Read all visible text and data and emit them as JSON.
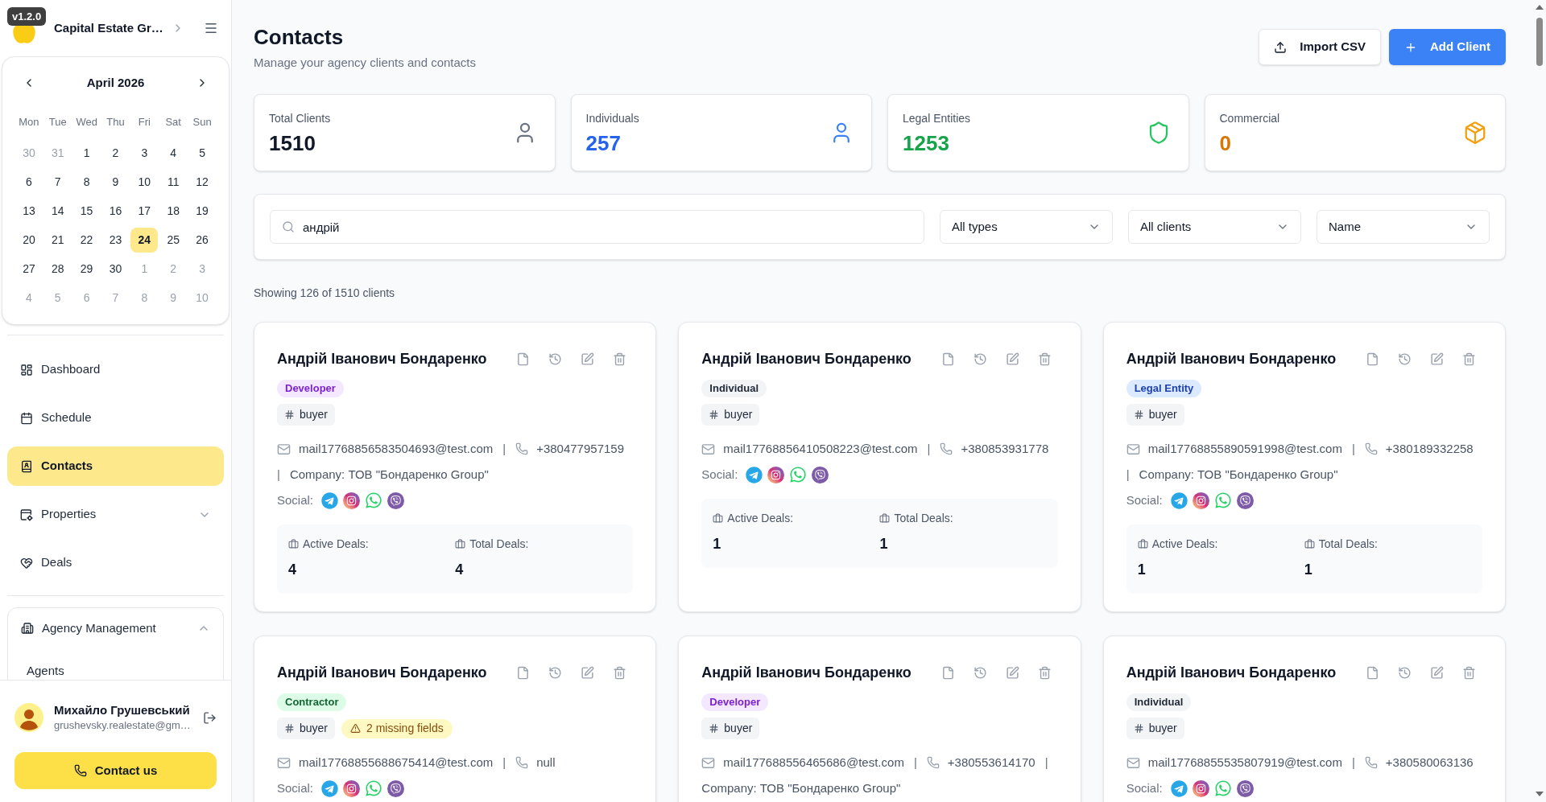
{
  "sidebar": {
    "version": "v1.2.0",
    "org_name": "Capital Estate Gr…",
    "calendar": {
      "month": "April 2026",
      "weekdays": [
        "Mon",
        "Tue",
        "Wed",
        "Thu",
        "Fri",
        "Sat",
        "Sun"
      ],
      "weeks": [
        [
          {
            "day": "30",
            "outside_month": true,
            "selected": false
          },
          {
            "day": "31",
            "outside_month": true,
            "selected": false
          },
          {
            "day": "1",
            "outside_month": false,
            "selected": false
          },
          {
            "day": "2",
            "outside_month": false,
            "selected": false
          },
          {
            "day": "3",
            "outside_month": false,
            "selected": false
          },
          {
            "day": "4",
            "outside_month": false,
            "selected": false
          },
          {
            "day": "5",
            "outside_month": false,
            "selected": false
          }
        ],
        [
          {
            "day": "6",
            "outside_month": false,
            "selected": false
          },
          {
            "day": "7",
            "outside_month": false,
            "selected": false
          },
          {
            "day": "8",
            "outside_month": false,
            "selected": false
          },
          {
            "day": "9",
            "outside_month": false,
            "selected": false
          },
          {
            "day": "10",
            "outside_month": false,
            "selected": false
          },
          {
            "day": "11",
            "outside_month": false,
            "selected": false
          },
          {
            "day": "12",
            "outside_month": false,
            "selected": false
          }
        ],
        [
          {
            "day": "13",
            "outside_month": false,
            "selected": false
          },
          {
            "day": "14",
            "outside_month": false,
            "selected": false
          },
          {
            "day": "15",
            "outside_month": false,
            "selected": false
          },
          {
            "day": "16",
            "outside_month": false,
            "selected": false
          },
          {
            "day": "17",
            "outside_month": false,
            "selected": false
          },
          {
            "day": "18",
            "outside_month": false,
            "selected": false
          },
          {
            "day": "19",
            "outside_month": false,
            "selected": false
          }
        ],
        [
          {
            "day": "20",
            "outside_month": false,
            "selected": false
          },
          {
            "day": "21",
            "outside_month": false,
            "selected": false
          },
          {
            "day": "22",
            "outside_month": false,
            "selected": false
          },
          {
            "day": "23",
            "outside_month": false,
            "selected": false
          },
          {
            "day": "24",
            "outside_month": false,
            "selected": true
          },
          {
            "day": "25",
            "outside_month": false,
            "selected": false
          },
          {
            "day": "26",
            "outside_month": false,
            "selected": false
          }
        ],
        [
          {
            "day": "27",
            "outside_month": false,
            "selected": false
          },
          {
            "day": "28",
            "outside_month": false,
            "selected": false
          },
          {
            "day": "29",
            "outside_month": false,
            "selected": false
          },
          {
            "day": "30",
            "outside_month": false,
            "selected": false
          },
          {
            "day": "1",
            "outside_month": true,
            "selected": false
          },
          {
            "day": "2",
            "outside_month": true,
            "selected": false
          },
          {
            "day": "3",
            "outside_month": true,
            "selected": false
          }
        ],
        [
          {
            "day": "4",
            "outside_month": true,
            "selected": false
          },
          {
            "day": "5",
            "outside_month": true,
            "selected": false
          },
          {
            "day": "6",
            "outside_month": true,
            "selected": false
          },
          {
            "day": "7",
            "outside_month": true,
            "selected": false
          },
          {
            "day": "8",
            "outside_month": true,
            "selected": false
          },
          {
            "day": "9",
            "outside_month": true,
            "selected": false
          },
          {
            "day": "10",
            "outside_month": true,
            "selected": false
          }
        ]
      ]
    },
    "nav": [
      {
        "label": "Dashboard",
        "kind": "link",
        "selected": false
      },
      {
        "label": "Schedule",
        "kind": "link",
        "selected": false
      },
      {
        "label": "Contacts",
        "kind": "link",
        "selected": true
      },
      {
        "label": "Properties",
        "kind": "group",
        "selected": false,
        "expanded": false
      },
      {
        "label": "Deals",
        "kind": "link",
        "selected": false
      }
    ],
    "sections": [
      {
        "label": "Agency Management",
        "expanded": true,
        "children": [
          {
            "label": "Agents",
            "selected": false
          }
        ]
      }
    ],
    "user": {
      "name": "Михайло Грушевський",
      "email": "grushevsky.realestate@gm…"
    },
    "contact_button": "Contact us"
  },
  "header": {
    "title": "Contacts",
    "subtitle": "Manage your agency clients and contacts",
    "buttons": [
      {
        "label": "Import CSV",
        "kind": "secondary"
      },
      {
        "label": "Add Client",
        "kind": "primary"
      }
    ]
  },
  "stats": [
    {
      "label": "Total Clients",
      "value": "1510",
      "kind": "all",
      "color": "#111827"
    },
    {
      "label": "Individuals",
      "value": "257",
      "kind": "individual",
      "color": "#2563eb"
    },
    {
      "label": "Legal Entities",
      "value": "1253",
      "kind": "legal",
      "color": "#16a34a"
    },
    {
      "label": "Commercial",
      "value": "0",
      "kind": "commercial",
      "color": "#d97706"
    }
  ],
  "filters": {
    "search": {
      "value": "андрій"
    },
    "selects": [
      {
        "value": "All types"
      },
      {
        "value": "All clients"
      },
      {
        "value": "Name"
      }
    ]
  },
  "summary": "Showing 126 of 1510 clients",
  "clients": [
    {
      "name": "Андрій Іванович Бондаренко",
      "type": {
        "label": "Developer",
        "kind": "developer"
      },
      "tags": [
        {
          "label": "buyer",
          "kind": "tag"
        }
      ],
      "contact": [
        {
          "kind": "email",
          "text": "mail17768856583504693@test.com"
        },
        {
          "kind": "separator",
          "text": "|"
        },
        {
          "kind": "phone",
          "text": "+380477957159"
        },
        {
          "kind": "separator",
          "text": "|"
        },
        {
          "kind": "company",
          "text": "Company: ТОВ \"Бондаренко Group\""
        }
      ],
      "social": {
        "label": "Social:"
      },
      "deals": [
        {
          "label": "Active Deals:",
          "value": "4"
        },
        {
          "label": "Total Deals:",
          "value": "4"
        }
      ]
    },
    {
      "name": "Андрій Іванович Бондаренко",
      "type": {
        "label": "Individual",
        "kind": "individual"
      },
      "tags": [
        {
          "label": "buyer",
          "kind": "tag"
        }
      ],
      "contact": [
        {
          "kind": "email",
          "text": "mail17768856410508223@test.com"
        },
        {
          "kind": "separator",
          "text": "|"
        },
        {
          "kind": "phone",
          "text": "+380853931778"
        }
      ],
      "social": {
        "label": "Social:"
      },
      "deals": [
        {
          "label": "Active Deals:",
          "value": "1"
        },
        {
          "label": "Total Deals:",
          "value": "1"
        }
      ]
    },
    {
      "name": "Андрій Іванович Бондаренко",
      "type": {
        "label": "Legal Entity",
        "kind": "legal_entity"
      },
      "tags": [
        {
          "label": "buyer",
          "kind": "tag"
        }
      ],
      "contact": [
        {
          "kind": "email",
          "text": "mail17768855890591998@test.com"
        },
        {
          "kind": "separator",
          "text": "|"
        },
        {
          "kind": "phone",
          "text": "+380189332258"
        },
        {
          "kind": "separator",
          "text": "|"
        },
        {
          "kind": "company",
          "text": "Company: ТОВ \"Бондаренко Group\""
        }
      ],
      "social": {
        "label": "Social:"
      },
      "deals": [
        {
          "label": "Active Deals:",
          "value": "1"
        },
        {
          "label": "Total Deals:",
          "value": "1"
        }
      ]
    },
    {
      "name": "Андрій Іванович Бондаренко",
      "type": {
        "label": "Contractor",
        "kind": "contractor"
      },
      "tags": [
        {
          "label": "buyer",
          "kind": "tag"
        },
        {
          "label": "2 missing fields",
          "kind": "warning"
        }
      ],
      "contact": [
        {
          "kind": "email",
          "text": "mail17768855688675414@test.com"
        },
        {
          "kind": "separator",
          "text": "|"
        },
        {
          "kind": "phone",
          "text": "null"
        }
      ],
      "social": {
        "label": "Social:"
      }
    },
    {
      "name": "Андрій Іванович Бондаренко",
      "type": {
        "label": "Developer",
        "kind": "developer"
      },
      "tags": [
        {
          "label": "buyer",
          "kind": "tag"
        }
      ],
      "contact": [
        {
          "kind": "email",
          "text": "mail177688556465686@test.com"
        },
        {
          "kind": "separator",
          "text": "|"
        },
        {
          "kind": "phone",
          "text": "+380553614170"
        },
        {
          "kind": "separator",
          "text": "|"
        },
        {
          "kind": "company",
          "text": "Company: ТОВ \"Бондаренко Group\""
        }
      ]
    },
    {
      "name": "Андрій Іванович Бондаренко",
      "type": {
        "label": "Individual",
        "kind": "individual"
      },
      "tags": [
        {
          "label": "buyer",
          "kind": "tag"
        }
      ],
      "contact": [
        {
          "kind": "email",
          "text": "mail17768855535807919@test.com"
        },
        {
          "kind": "separator",
          "text": "|"
        },
        {
          "kind": "phone",
          "text": "+380580063136"
        }
      ],
      "social": {
        "label": "Social:"
      }
    }
  ]
}
